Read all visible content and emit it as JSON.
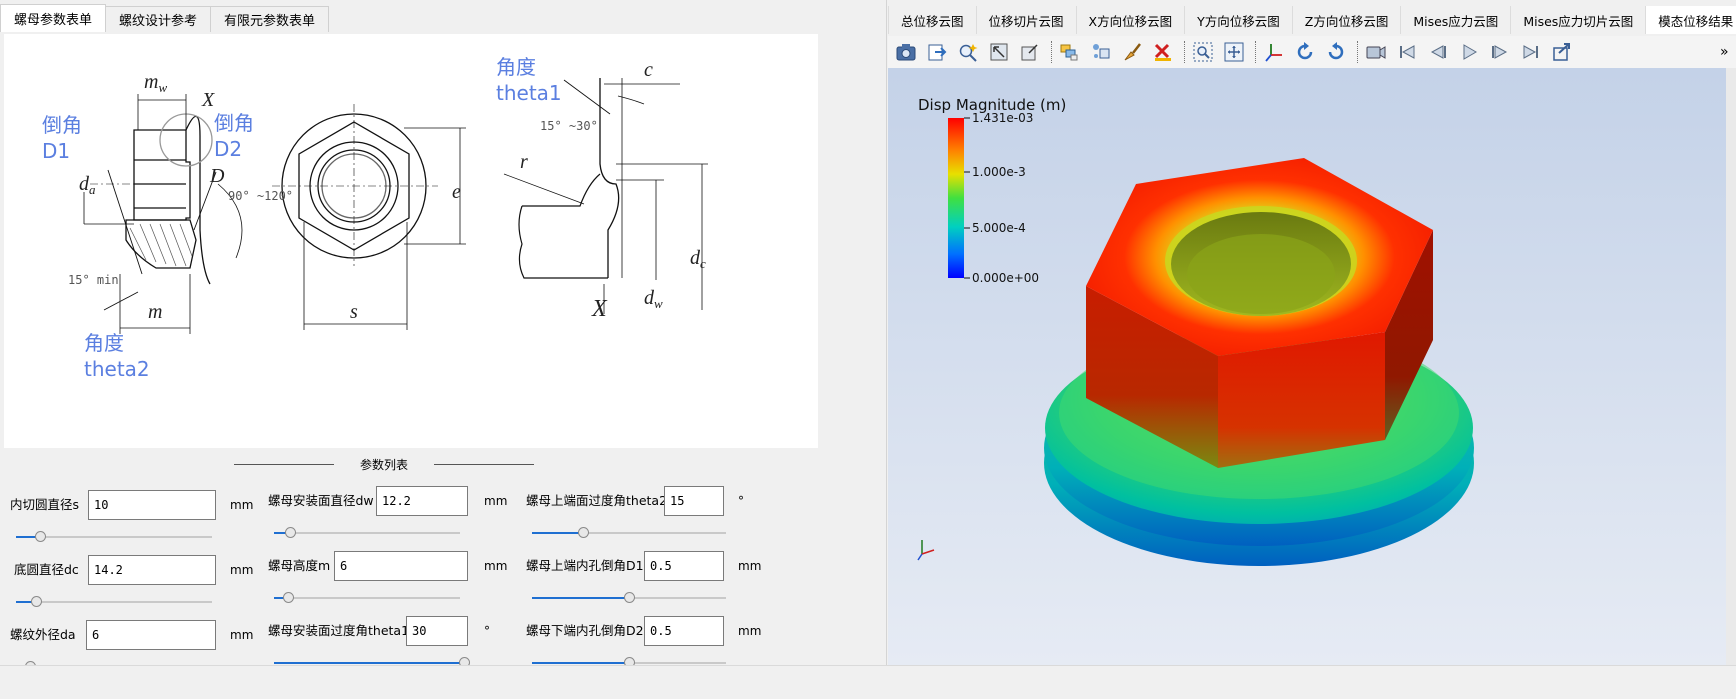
{
  "left_tabs": [
    {
      "label": "螺母参数表单",
      "active": true
    },
    {
      "label": "螺纹设计参考",
      "active": false
    },
    {
      "label": "有限元参数表单",
      "active": false
    }
  ],
  "drawing": {
    "mw": "m",
    "mw_sub": "w",
    "X": "X",
    "chamfer1": {
      "l1": "倒角",
      "l2": "D1"
    },
    "chamfer2": {
      "l1": "倒角",
      "l2": "D2"
    },
    "da": "d",
    "da_sub": "a",
    "D": "D",
    "angle_90_120": "90° ~120°",
    "angle_15min": "15° min",
    "m": "m",
    "s": "s",
    "e": "e",
    "theta2": {
      "l1": "角度",
      "l2": "theta2"
    },
    "theta1": {
      "l1": "角度",
      "l2": "theta1"
    },
    "c": "c",
    "angle_15_30": "15° ~30°",
    "r": "r",
    "dc": "d",
    "dc_sub": "c",
    "dw": "d",
    "dw_sub": "w",
    "X2": "X"
  },
  "params_group_title": "参数列表",
  "params": [
    {
      "label": "内切圆直径s",
      "value": "10",
      "unit": "mm",
      "slider": 0.1
    },
    {
      "label": "底圆直径dc",
      "value": "14.2",
      "unit": "mm",
      "slider": 0.08
    },
    {
      "label": "螺纹外径da",
      "value": "6",
      "unit": "mm",
      "slider": 0.05
    },
    {
      "label": "螺母安装面直径dw",
      "value": "12.2",
      "unit": "mm",
      "slider": 0.06
    },
    {
      "label": "螺母高度m",
      "value": "6",
      "unit": "mm",
      "slider": 0.05
    },
    {
      "label": "螺母安装面过度角theta1",
      "value": "30",
      "unit": "°",
      "slider": 1.0
    },
    {
      "label": "螺母上端面过度角theta2",
      "value": "15",
      "unit": "°",
      "slider": 0.25
    },
    {
      "label": "螺母上端内孔倒角D1",
      "value": "0.5",
      "unit": "mm",
      "slider": 0.5
    },
    {
      "label": "螺母下端内孔倒角D2",
      "value": "0.5",
      "unit": "mm",
      "slider": 0.5
    }
  ],
  "right_tabs": [
    {
      "label": "总位移云图",
      "active": false
    },
    {
      "label": "位移切片云图",
      "active": false
    },
    {
      "label": "X方向位移云图",
      "active": false
    },
    {
      "label": "Y方向位移云图",
      "active": false
    },
    {
      "label": "Z方向位移云图",
      "active": false
    },
    {
      "label": "Mises应力云图",
      "active": false
    },
    {
      "label": "Mises应力切片云图",
      "active": false
    },
    {
      "label": "模态位移结果",
      "active": true
    }
  ],
  "tab_scroll": {
    "left": "◀",
    "right": "▶"
  },
  "toolbar_icons": [
    "camera-icon",
    "export-icon",
    "zoom-magic-icon",
    "select-region-icon",
    "select-cell-icon",
    "color-layers-icon",
    "points-icon",
    "brush-icon",
    "clear-selection-icon",
    "zoom-box-icon",
    "zoom-fit-icon",
    "axes-icon",
    "rotate-icon",
    "reset-rotate-icon",
    "record-icon",
    "first-frame-icon",
    "prev-frame-icon",
    "play-icon",
    "next-frame-icon",
    "last-frame-icon",
    "loop-icon"
  ],
  "toolbar_more": "»",
  "viewport": {
    "colorbar_title": "Disp Magnitude (m)",
    "ticks": [
      "1.431e-03",
      "1.000e-3",
      "5.000e-4",
      "0.000e+00"
    ],
    "bg_top": "#c4d2e8",
    "bg_bottom": "#e6ebf4"
  }
}
